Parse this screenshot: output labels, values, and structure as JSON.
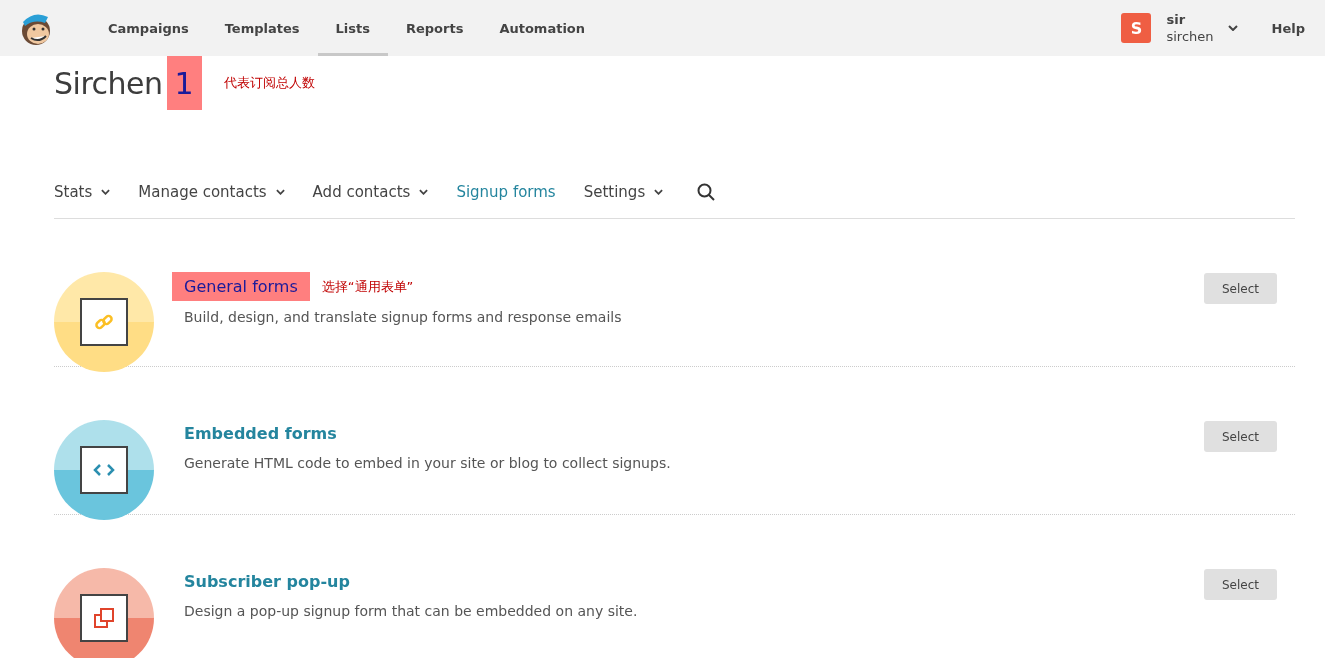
{
  "nav": {
    "items": [
      {
        "label": "Campaigns",
        "selected": false
      },
      {
        "label": "Templates",
        "selected": false
      },
      {
        "label": "Lists",
        "selected": true
      },
      {
        "label": "Reports",
        "selected": false
      },
      {
        "label": "Automation",
        "selected": false
      }
    ],
    "account": {
      "avatar_letter": "S",
      "name": "sir",
      "username": "sirchen"
    },
    "help": "Help"
  },
  "list": {
    "name": "Sirchen",
    "count": "1",
    "count_highlighted": true,
    "note": "代表订阅总人数"
  },
  "subnav": {
    "items": [
      {
        "label": "Stats",
        "dropdown": true,
        "selected": false
      },
      {
        "label": "Manage contacts",
        "dropdown": true,
        "selected": false
      },
      {
        "label": "Add contacts",
        "dropdown": true,
        "selected": false
      },
      {
        "label": "Signup forms",
        "dropdown": false,
        "selected": true
      },
      {
        "label": "Settings",
        "dropdown": true,
        "selected": false
      }
    ]
  },
  "forms": [
    {
      "kind": "general",
      "title": "General forms",
      "highlighted": true,
      "note": "选择“通用表单”",
      "description": "Build, design, and translate signup forms and response emails",
      "button": "Select"
    },
    {
      "kind": "embedded",
      "title": "Embedded forms",
      "highlighted": false,
      "description": "Generate HTML code to embed in your site or blog to collect signups.",
      "button": "Select"
    },
    {
      "kind": "popup",
      "title": "Subscriber pop-up",
      "highlighted": false,
      "description": "Design a pop-up signup form that can be embedded on any site.",
      "button": "Select"
    }
  ]
}
